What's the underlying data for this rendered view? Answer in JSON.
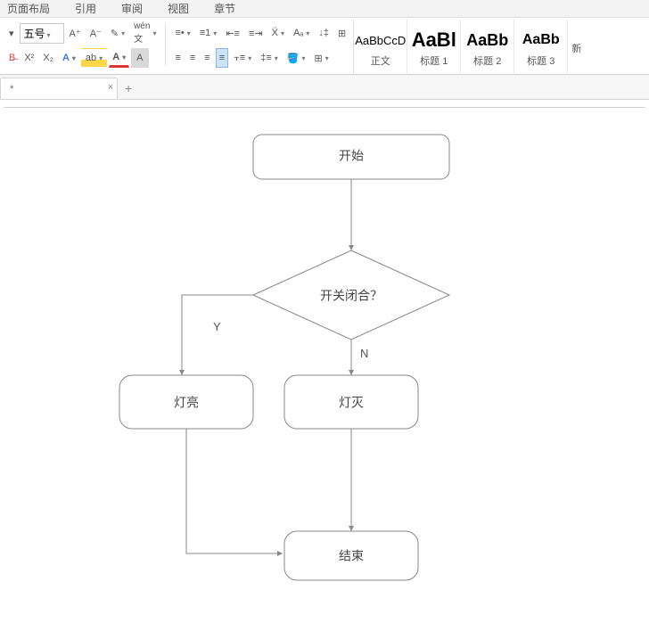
{
  "menu": {
    "items": [
      "页面布局",
      "引用",
      "审阅",
      "视图",
      "章节"
    ]
  },
  "ribbon": {
    "font_size_label": "五号",
    "styles": [
      {
        "preview": "AaBbCcD",
        "label": "正文",
        "size": "13px",
        "weight": "normal"
      },
      {
        "preview": "AaBl",
        "label": "标题 1",
        "size": "22px",
        "weight": "bold"
      },
      {
        "preview": "AaBb",
        "label": "标题 2",
        "size": "18px",
        "weight": "bold"
      },
      {
        "preview": "AaBb",
        "label": "标题 3",
        "size": "16px",
        "weight": "bold"
      }
    ],
    "new_style": "新"
  },
  "tab": {
    "filename": "*",
    "close": "×",
    "add": "+"
  },
  "flowchart": {
    "start": "开始",
    "decision": "开关闭合？",
    "yes": "Y",
    "no": "N",
    "left": "灯亮",
    "right": "灯灭",
    "end": "结束"
  }
}
